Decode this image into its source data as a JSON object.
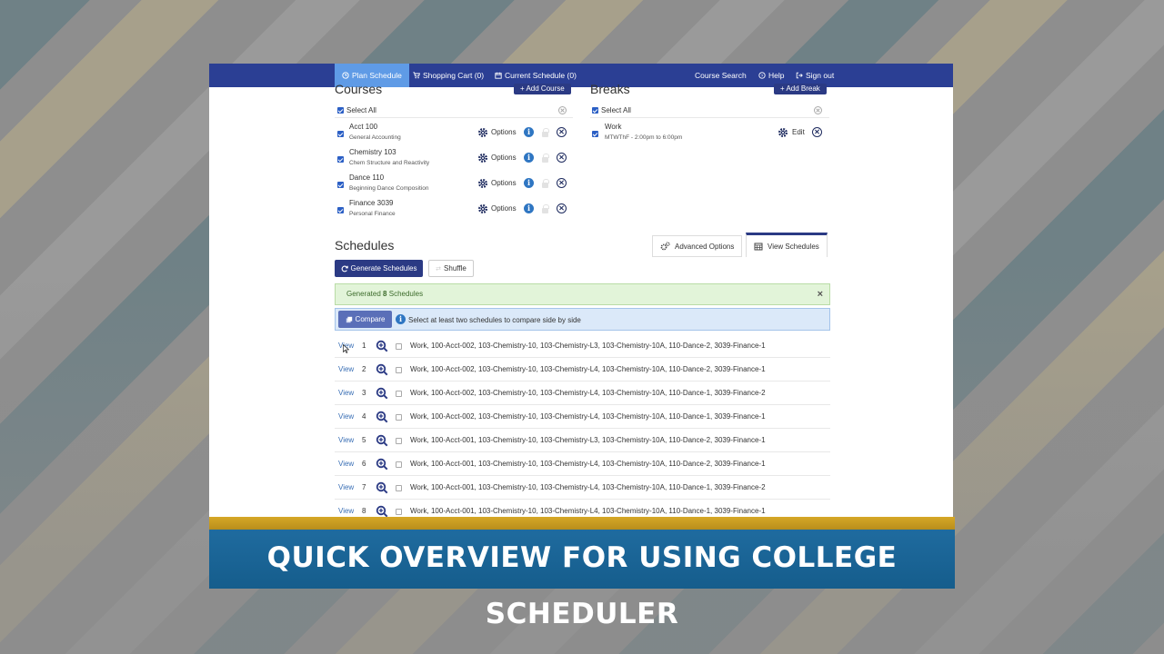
{
  "nav": {
    "plan": "Plan Schedule",
    "cart": "Shopping Cart (0)",
    "current": "Current Schedule (0)",
    "search": "Course Search",
    "help": "Help",
    "signout": "Sign out"
  },
  "courses": {
    "title": "Courses",
    "add_button": "+ Add Course",
    "select_all": "Select All",
    "options_label": "Options",
    "items": [
      {
        "name": "Acct 100",
        "desc": "General Accounting"
      },
      {
        "name": "Chemistry 103",
        "desc": "Chem Structure and Reactivity"
      },
      {
        "name": "Dance 110",
        "desc": "Beginning Dance Composition"
      },
      {
        "name": "Finance 3039",
        "desc": "Personal Finance"
      }
    ]
  },
  "breaks": {
    "title": "Breaks",
    "add_button": "+ Add Break",
    "select_all": "Select All",
    "edit_label": "Edit",
    "items": [
      {
        "name": "Work",
        "desc": "MTWThF - 2:00pm to 6:00pm"
      }
    ]
  },
  "schedules": {
    "title": "Schedules",
    "advanced_tab": "Advanced Options",
    "view_tab": "View Schedules",
    "generate_button": "Generate Schedules",
    "shuffle_button": "Shuffle",
    "generated_prefix": "Generated",
    "generated_count": "8",
    "generated_suffix": "Schedules",
    "close_glyph": "×",
    "compare_button": "Compare",
    "compare_hint": "Select at least two schedules to compare side by side",
    "view_label": "View",
    "rows": [
      {
        "num": "1",
        "desc": "Work, 100-Acct-002, 103-Chemistry-10, 103-Chemistry-L3, 103-Chemistry-10A, 110-Dance-2, 3039-Finance-1"
      },
      {
        "num": "2",
        "desc": "Work, 100-Acct-002, 103-Chemistry-10, 103-Chemistry-L4, 103-Chemistry-10A, 110-Dance-2, 3039-Finance-1"
      },
      {
        "num": "3",
        "desc": "Work, 100-Acct-002, 103-Chemistry-10, 103-Chemistry-L4, 103-Chemistry-10A, 110-Dance-1, 3039-Finance-2"
      },
      {
        "num": "4",
        "desc": "Work, 100-Acct-002, 103-Chemistry-10, 103-Chemistry-L4, 103-Chemistry-10A, 110-Dance-1, 3039-Finance-1"
      },
      {
        "num": "5",
        "desc": "Work, 100-Acct-001, 103-Chemistry-10, 103-Chemistry-L3, 103-Chemistry-10A, 110-Dance-2, 3039-Finance-1"
      },
      {
        "num": "6",
        "desc": "Work, 100-Acct-001, 103-Chemistry-10, 103-Chemistry-L4, 103-Chemistry-10A, 110-Dance-2, 3039-Finance-1"
      },
      {
        "num": "7",
        "desc": "Work, 100-Acct-001, 103-Chemistry-10, 103-Chemistry-L4, 103-Chemistry-10A, 110-Dance-1, 3039-Finance-2"
      },
      {
        "num": "8",
        "desc": "Work, 100-Acct-001, 103-Chemistry-10, 103-Chemistry-L4, 103-Chemistry-10A, 110-Dance-1, 3039-Finance-1"
      }
    ]
  },
  "caption": "QUICK OVERVIEW FOR USING COLLEGE SCHEDULER",
  "colors": {
    "nav_bg": "#2b3f94",
    "nav_active": "#5f9be6",
    "caption_bg": "#1f6b9f",
    "caption_accent": "#d6a826"
  }
}
